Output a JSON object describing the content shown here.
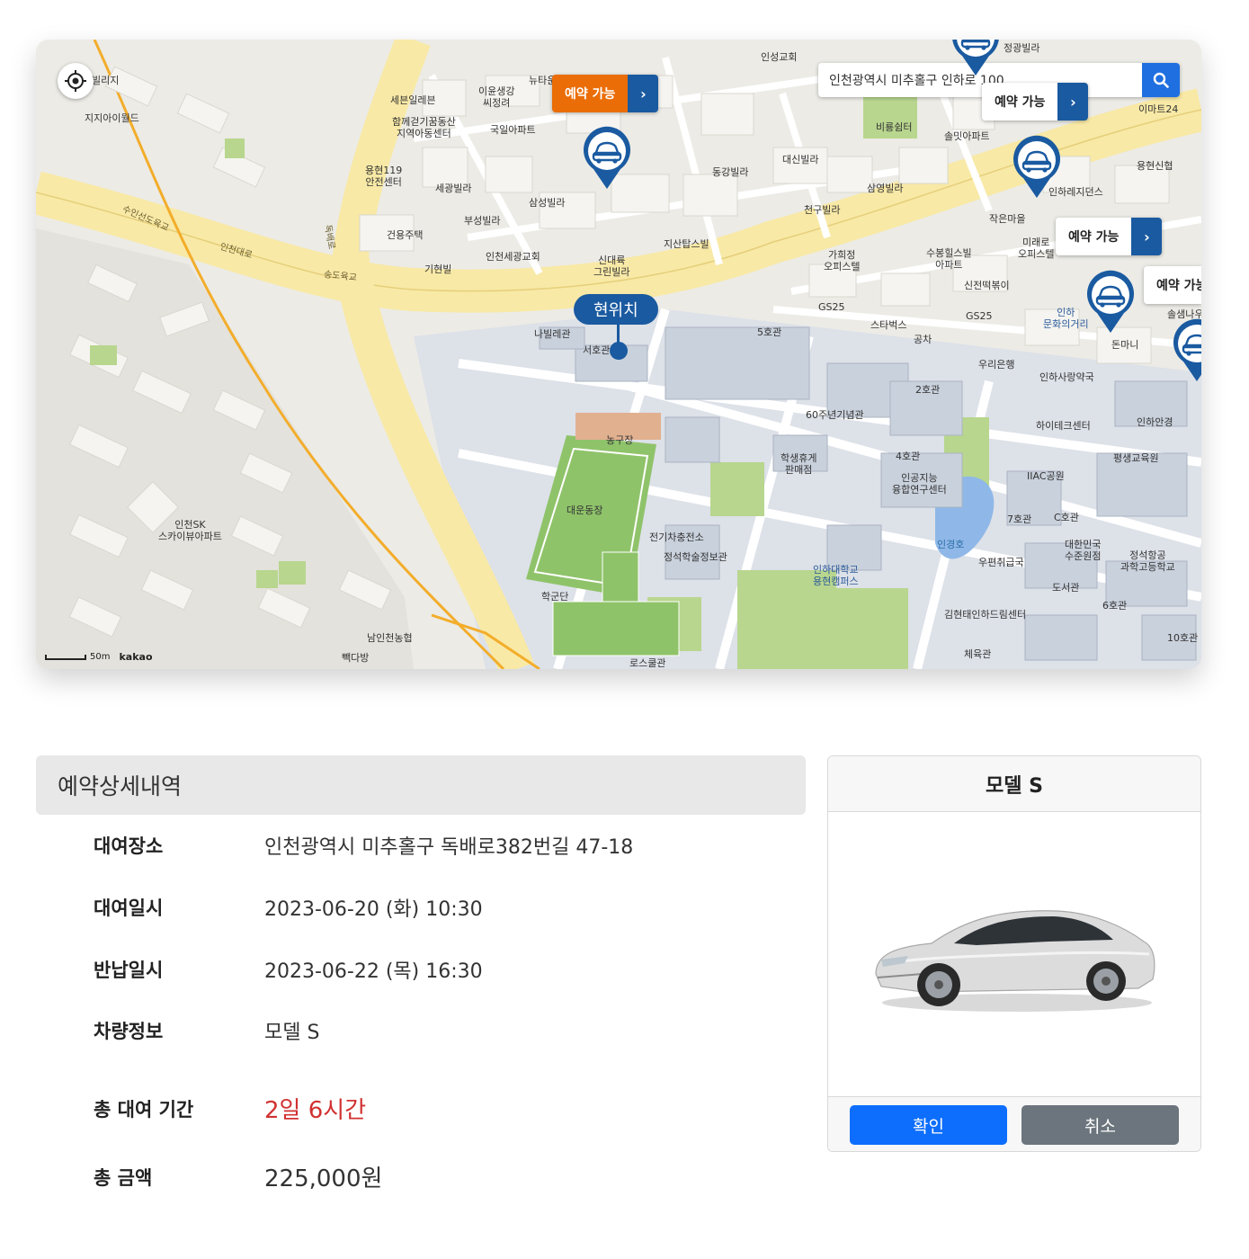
{
  "map": {
    "search": {
      "value": "인천광역시 미추홀구 인하로 100"
    },
    "current_location_label": "현위치",
    "reserve_label": "예약 가능",
    "reserve_label_cut": "예약 가능",
    "scale": "50m",
    "provider": "kakao",
    "labels": {
      "l1": "빌리지",
      "l2": "지지아이월드",
      "l3": "세븐일레븐",
      "l4": "함께걷기꿈동산\n지역아동센터",
      "l5": "이윤생강\n씨정려",
      "l6": "뉴타운",
      "l7": "국일아파트",
      "l8": "용현119\n안전센터",
      "l9": "세광빌라",
      "l10": "삼성빌라",
      "l11": "부성빌라",
      "l12": "건용주택",
      "l13": "인천세광교회",
      "l14": "기현빌",
      "l15": "신대륙\n그린빌라",
      "l16": "지산탑스빌",
      "l17": "동강빌라",
      "l18": "대신빌라",
      "l19": "천구빌라",
      "l20": "인성교회",
      "l21": "정광빌라",
      "l22": "비룡쉼터",
      "l23": "솔밋아파트",
      "l24": "삼영빌라",
      "l25": "작은마을",
      "l26": "인하레지던스",
      "l27": "용현신협",
      "l28": "이마트24",
      "l29": "미래로\n오피스텔",
      "l30": "수봉힐스빌\n아파트",
      "l31": "가희정\n오피스텔",
      "l32": "신전떡볶이",
      "l33": "GS25",
      "l34": "스타벅스",
      "l35": "GS25",
      "l36": "인하\n문화의거리",
      "l37": "돈마니",
      "l38": "솔샘나우",
      "l39": "공차",
      "l40": "우리은행",
      "l41": "인하사랑약국",
      "l42": "인하안경",
      "l43": "하이테크센터",
      "l44": "평생교육원",
      "l45": "나빌레관",
      "l46": "서호관",
      "l47": "5호관",
      "l48": "2호관",
      "l49": "60주년기념관",
      "l50": "농구장",
      "l51": "대운동장",
      "l52": "학생휴게\n판매점",
      "l53": "4호관",
      "l54": "인공지능\n융합연구센터",
      "l55": "IIAC공원",
      "l56": "인경호",
      "l57": "7호관",
      "l58": "C호관",
      "l59": "대한민국\n수준원점",
      "l60": "정석항공\n과학고등학교",
      "l61": "전기차충전소",
      "l62": "정석학술정보관",
      "l63": "인하대학교\n용현캠퍼스",
      "l64": "우편취급국",
      "l65": "도서관",
      "l66": "6호관",
      "l67": "학군단",
      "l68": "김현태인하드림센터",
      "l69": "체육관",
      "l70": "10호관",
      "l71": "인천SK\n스카이뷰아파트",
      "l72": "남인천농협",
      "l73": "빽다방",
      "l74": "로스쿨관",
      "l75": "수인선도육교",
      "l76": "인천대로",
      "l77": "송도육교",
      "l78": "독배로"
    }
  },
  "details": {
    "heading": "예약상세내역",
    "rows": [
      {
        "label": "대여장소",
        "value": "인천광역시 미추홀구 독배로382번길 47-18"
      },
      {
        "label": "대여일시",
        "value": "2023-06-20 (화) 10:30"
      },
      {
        "label": "반납일시",
        "value": "2023-06-22 (목) 16:30"
      },
      {
        "label": "차량정보",
        "value": "모델 S"
      },
      {
        "label": "총 대여 기간",
        "value": "2일 6시간"
      },
      {
        "label": "총 금액",
        "value": "225,000원"
      }
    ]
  },
  "car_card": {
    "title": "모델 S",
    "confirm_label": "확인",
    "cancel_label": "취소"
  },
  "colors": {
    "brand_blue": "#1a5aa0",
    "reserve_orange": "#ea6d07",
    "primary_button": "#0d6efd",
    "secondary_button": "#6c757d",
    "duration_red": "#d13131"
  },
  "icons": {
    "locate": "crosshair-icon",
    "search": "search-icon",
    "car_pin": "car-marker-icon",
    "arrow": "chevron-right-icon"
  }
}
